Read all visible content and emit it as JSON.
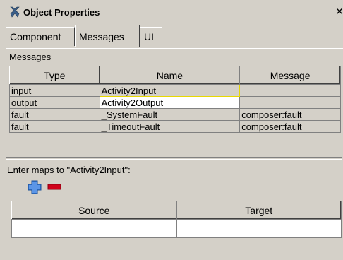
{
  "window": {
    "title": "Object Properties",
    "close_label": "✕"
  },
  "tabs": [
    {
      "label": "Component",
      "active": false
    },
    {
      "label": "Messages",
      "active": true
    },
    {
      "label": "UI",
      "active": false
    }
  ],
  "messages": {
    "section_label": "Messages",
    "columns": [
      "Type",
      "Name",
      "Message"
    ],
    "rows": [
      {
        "type": "input",
        "name": "Activity2Input",
        "message": ""
      },
      {
        "type": "output",
        "name": "Activity2Output",
        "message": ""
      },
      {
        "type": "fault",
        "name": "_SystemFault",
        "message": "composer:fault"
      },
      {
        "type": "fault",
        "name": "_TimeoutFault",
        "message": "composer:fault"
      }
    ]
  },
  "maps": {
    "prompt": "Enter maps to \"Activity2Input\":",
    "columns": [
      "Source",
      "Target"
    ],
    "add_icon": "plus-icon",
    "remove_icon": "minus-icon"
  },
  "colors": {
    "add": "#3a7bd5",
    "remove": "#d0021b",
    "selection": "#e8d800"
  }
}
